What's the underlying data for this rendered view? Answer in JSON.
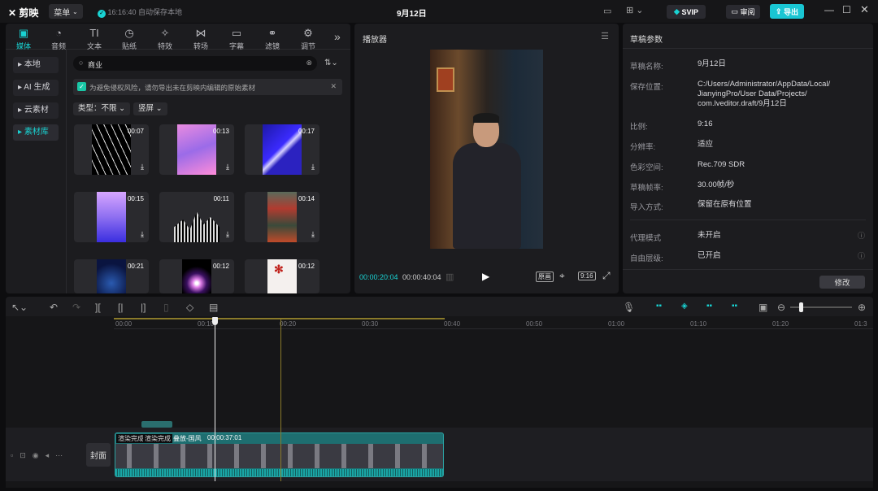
{
  "app": {
    "name": "剪映",
    "menu_label": "菜单",
    "autosave": "16:16:40 自动保存本地",
    "project_title": "9月12日",
    "svip_label": "SVIP",
    "review_label": "审阅",
    "export_label": "导出"
  },
  "colors": {
    "accent": "#19d3d3",
    "gold": "#c9b037",
    "bg": "#0d0d0f",
    "panel": "#1c1c1f"
  },
  "toolbar": {
    "tabs": [
      {
        "label": "媒体",
        "icon": "media-icon"
      },
      {
        "label": "音频",
        "icon": "audio-icon"
      },
      {
        "label": "文本",
        "icon": "text-icon"
      },
      {
        "label": "贴纸",
        "icon": "sticker-icon"
      },
      {
        "label": "特效",
        "icon": "effects-icon"
      },
      {
        "label": "转场",
        "icon": "transition-icon"
      },
      {
        "label": "字幕",
        "icon": "caption-icon"
      },
      {
        "label": "滤镜",
        "icon": "filter-icon"
      },
      {
        "label": "调节",
        "icon": "adjust-icon"
      }
    ],
    "active": "媒体"
  },
  "sidebar": {
    "items": [
      {
        "label": "本地"
      },
      {
        "label": "AI 生成"
      },
      {
        "label": "云素材"
      },
      {
        "label": "素材库"
      }
    ],
    "active": "素材库"
  },
  "library": {
    "search_value": "商业",
    "notice": "为避免侵权风险，请勿导出未在剪映内编辑的原始素材",
    "filter_type": "类型：不限",
    "filter_orientation": "竖屏",
    "items": [
      {
        "duration": "00:07"
      },
      {
        "duration": "00:13"
      },
      {
        "duration": "00:17"
      },
      {
        "duration": "00:15"
      },
      {
        "duration": "00:11"
      },
      {
        "duration": "00:14"
      },
      {
        "duration": "00:21"
      },
      {
        "duration": "00:12"
      },
      {
        "duration": "00:12"
      }
    ]
  },
  "player": {
    "title": "播放器",
    "current_time": "00:00:20:04",
    "total_time": "00:00:40:04",
    "original_label": "原画",
    "ratio_label": "9:16"
  },
  "draft": {
    "title": "草稿参数",
    "fields": [
      {
        "key": "草稿名称:",
        "value": "9月12日"
      },
      {
        "key": "保存位置:",
        "value": "C:/Users/Administrator/AppData/Local/ JianyingPro/User Data/Projects/ com.lveditor.draft/9月12日"
      },
      {
        "key": "比例:",
        "value": "9:16"
      },
      {
        "key": "分辨率:",
        "value": "适应"
      },
      {
        "key": "色彩空间:",
        "value": "Rec.709 SDR"
      },
      {
        "key": "草稿帧率:",
        "value": "30.00帧/秒"
      },
      {
        "key": "导入方式:",
        "value": "保留在原有位置"
      },
      {
        "key": "代理模式",
        "value": "未开启"
      },
      {
        "key": "自由层级:",
        "value": "已开启"
      }
    ],
    "modify_label": "修改"
  },
  "timeline": {
    "ruler": [
      "00:00",
      "00:10",
      "00:20",
      "00:30",
      "00:40",
      "00:50",
      "01:00",
      "01:10",
      "01:20",
      "01:3"
    ],
    "cover_label": "封面",
    "clip_tags": [
      "渲染完成",
      "渲染完成",
      "叠放-国风",
      "00:00:37:01"
    ],
    "playhead_fraction": 0.405
  }
}
